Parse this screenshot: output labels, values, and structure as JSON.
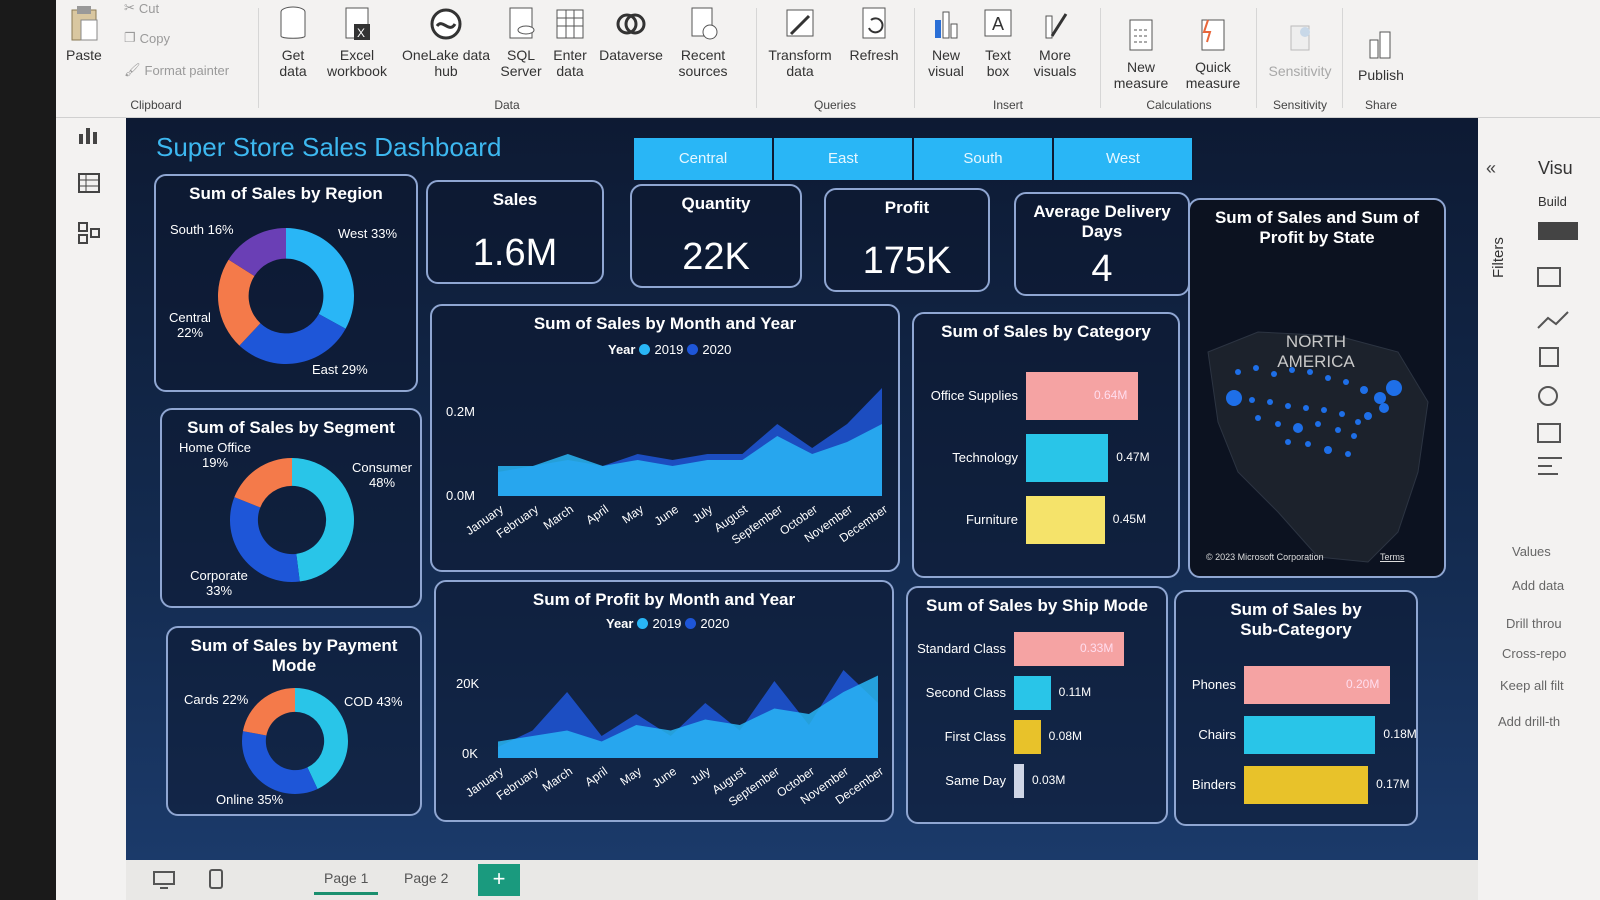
{
  "ribbon": {
    "clipboard": {
      "paste": "Paste",
      "cut": "Cut",
      "copy": "Copy",
      "format_painter": "Format painter",
      "group": "Clipboard"
    },
    "data": {
      "get_data": "Get data",
      "excel": "Excel workbook",
      "onelake": "OneLake data hub",
      "sql": "SQL Server",
      "enter": "Enter data",
      "dataverse": "Dataverse",
      "recent": "Recent sources",
      "group": "Data"
    },
    "queries": {
      "transform": "Transform data",
      "refresh": "Refresh",
      "group": "Queries"
    },
    "insert": {
      "new_visual": "New visual",
      "text_box": "Text box",
      "more_visuals": "More visuals",
      "group": "Insert"
    },
    "calculations": {
      "new_measure": "New measure",
      "quick_measure": "Quick measure",
      "group": "Calculations"
    },
    "sensitivity": {
      "label": "Sensitivity",
      "group": "Sensitivity"
    },
    "share": {
      "publish": "Publish",
      "group": "Share"
    }
  },
  "dashboard": {
    "title": "Super Store Sales Dashboard",
    "slicer": [
      "Central",
      "East",
      "South",
      "West"
    ],
    "kpis": [
      {
        "title": "Sales",
        "value": "1.6M"
      },
      {
        "title": "Quantity",
        "value": "22K"
      },
      {
        "title": "Profit",
        "value": "175K"
      },
      {
        "title": "Average Delivery Days",
        "value": "4"
      }
    ],
    "map": {
      "title": "Sum of Sales and Sum of Profit by State",
      "region_label": "NORTH AMERICA",
      "credit": "© 2023 Microsoft Corporation",
      "terms": "Terms"
    }
  },
  "chart_data": [
    {
      "type": "pie",
      "title": "Sum of Sales by Region",
      "labels": [
        "West 33%",
        "East 29%",
        "Central 22%",
        "South 16%"
      ],
      "values": [
        33,
        29,
        22,
        16
      ],
      "colors": [
        "#29b6f6",
        "#1e56d8",
        "#f47a4a",
        "#6a3fb5"
      ]
    },
    {
      "type": "pie",
      "title": "Sum of Sales by Segment",
      "labels": [
        "Consumer 48%",
        "Corporate 33%",
        "Home Office 19%"
      ],
      "values": [
        48,
        33,
        19
      ],
      "colors": [
        "#29c5e8",
        "#1e56d8",
        "#f47a4a"
      ]
    },
    {
      "type": "pie",
      "title": "Sum of Sales by Payment Mode",
      "labels": [
        "COD 43%",
        "Online 35%",
        "Cards 22%"
      ],
      "values": [
        43,
        35,
        22
      ],
      "colors": [
        "#29c5e8",
        "#1e56d8",
        "#f47a4a"
      ]
    },
    {
      "type": "area",
      "title": "Sum of Sales by Month and Year",
      "legend_title": "Year",
      "categories": [
        "January",
        "February",
        "March",
        "April",
        "May",
        "June",
        "July",
        "August",
        "September",
        "October",
        "November",
        "December"
      ],
      "yticks": [
        "0.2M",
        "0.0M"
      ],
      "series": [
        {
          "name": "2019",
          "color": "#29b6f6",
          "values": [
            0.05,
            0.05,
            0.07,
            0.05,
            0.06,
            0.05,
            0.06,
            0.06,
            0.1,
            0.07,
            0.09,
            0.12
          ]
        },
        {
          "name": "2020",
          "color": "#1e56d8",
          "values": [
            0.04,
            0.05,
            0.06,
            0.05,
            0.07,
            0.06,
            0.07,
            0.07,
            0.12,
            0.08,
            0.12,
            0.18
          ]
        }
      ]
    },
    {
      "type": "area",
      "title": "Sum of Profit by Month and Year",
      "legend_title": "Year",
      "categories": [
        "January",
        "February",
        "March",
        "April",
        "May",
        "June",
        "July",
        "August",
        "September",
        "October",
        "November",
        "December"
      ],
      "yticks": [
        "20K",
        "0K"
      ],
      "series": [
        {
          "name": "2019",
          "color": "#29b6f6",
          "values": [
            3000,
            4000,
            5000,
            3000,
            6000,
            5000,
            7000,
            6000,
            9000,
            8000,
            12000,
            15000
          ]
        },
        {
          "name": "2020",
          "color": "#1e56d8",
          "values": [
            2000,
            5000,
            12000,
            4000,
            8000,
            4000,
            10000,
            5000,
            14000,
            6000,
            16000,
            10000
          ]
        }
      ]
    },
    {
      "type": "bar",
      "title": "Sum of Sales by Category",
      "categories": [
        "Office Supplies",
        "Technology",
        "Furniture"
      ],
      "values": [
        0.64,
        0.47,
        0.45
      ],
      "labels": [
        "0.64M",
        "0.47M",
        "0.45M"
      ],
      "colors": [
        "#f5a3a3",
        "#29c5e8",
        "#f5e36a"
      ]
    },
    {
      "type": "bar",
      "title": "Sum of Sales by Ship Mode",
      "categories": [
        "Standard Class",
        "Second Class",
        "First Class",
        "Same Day"
      ],
      "values": [
        0.33,
        0.11,
        0.08,
        0.03
      ],
      "labels": [
        "0.33M",
        "0.11M",
        "0.08M",
        "0.03M"
      ],
      "colors": [
        "#f5a3a3",
        "#29c5e8",
        "#e8c22a",
        "#cfd6e6"
      ]
    },
    {
      "type": "bar",
      "title": "Sum of Sales by Sub-Category",
      "categories": [
        "Phones",
        "Chairs",
        "Binders"
      ],
      "values": [
        0.2,
        0.18,
        0.17
      ],
      "labels": [
        "0.20M",
        "0.18M",
        "0.17M"
      ],
      "colors": [
        "#f5a3a3",
        "#29c5e8",
        "#e8c22a"
      ]
    }
  ],
  "right_pane": {
    "filters": "Filters",
    "vis": "Visu",
    "build": "Build",
    "values": "Values",
    "add_data": "Add data",
    "drill": "Drill throu",
    "cross": "Cross-repo",
    "keep": "Keep all filt",
    "add_drill": "Add drill-th"
  },
  "pages": {
    "tab1": "Page 1",
    "tab2": "Page 2",
    "add": "+"
  },
  "colors": {
    "accent": "#29b6f6",
    "canvas": "#12203c",
    "dark_blue": "#1e56d8"
  }
}
